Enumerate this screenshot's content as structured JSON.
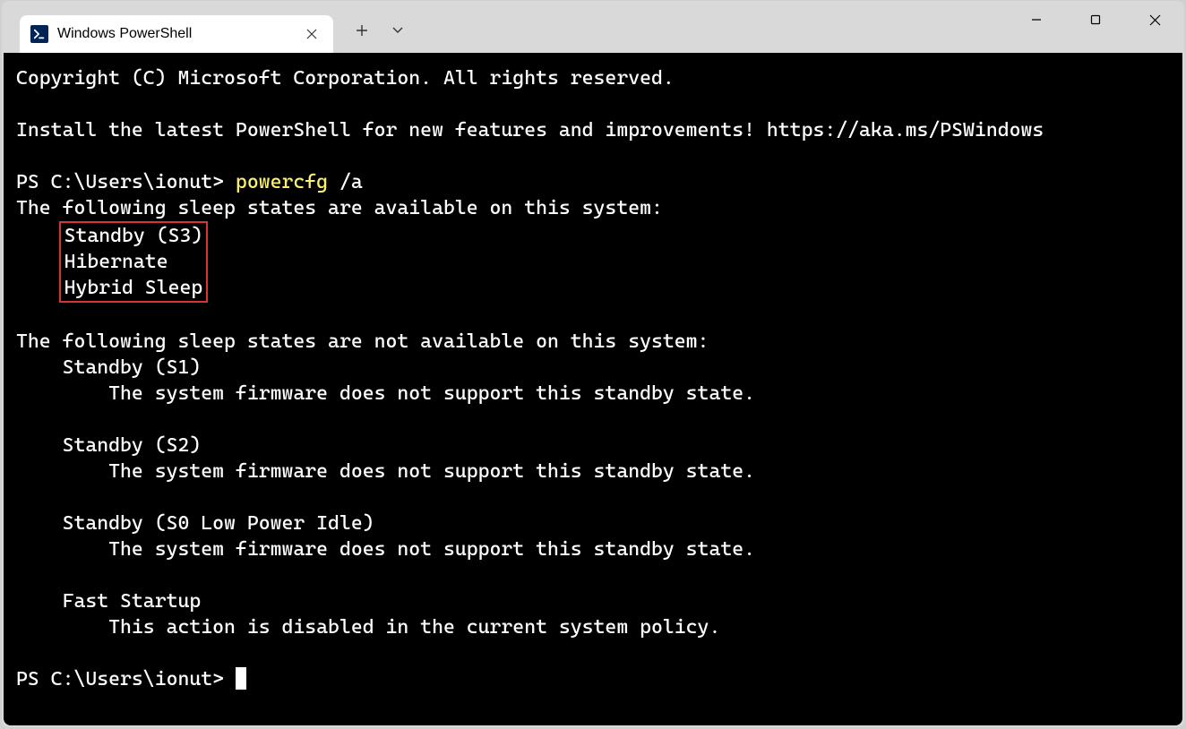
{
  "window": {
    "tab_title": "Windows PowerShell"
  },
  "terminal": {
    "copyright": "Copyright (C) Microsoft Corporation. All rights reserved.",
    "install_msg": "Install the latest PowerShell for new features and improvements! https://aka.ms/PSWindows",
    "prompt1_prefix": "PS C:\\Users\\ionut> ",
    "command": "powercfg",
    "command_arg": " /a",
    "available_header": "The following sleep states are available on this system:",
    "available": {
      "s3": "Standby (S3)",
      "hibernate": "Hibernate",
      "hybrid": "Hybrid Sleep"
    },
    "not_available_header": "The following sleep states are not available on this system:",
    "not_available": [
      {
        "name": "Standby (S1)",
        "reason": "The system firmware does not support this standby state."
      },
      {
        "name": "Standby (S2)",
        "reason": "The system firmware does not support this standby state."
      },
      {
        "name": "Standby (S0 Low Power Idle)",
        "reason": "The system firmware does not support this standby state."
      },
      {
        "name": "Fast Startup",
        "reason": "This action is disabled in the current system policy."
      }
    ],
    "prompt2": "PS C:\\Users\\ionut> "
  }
}
